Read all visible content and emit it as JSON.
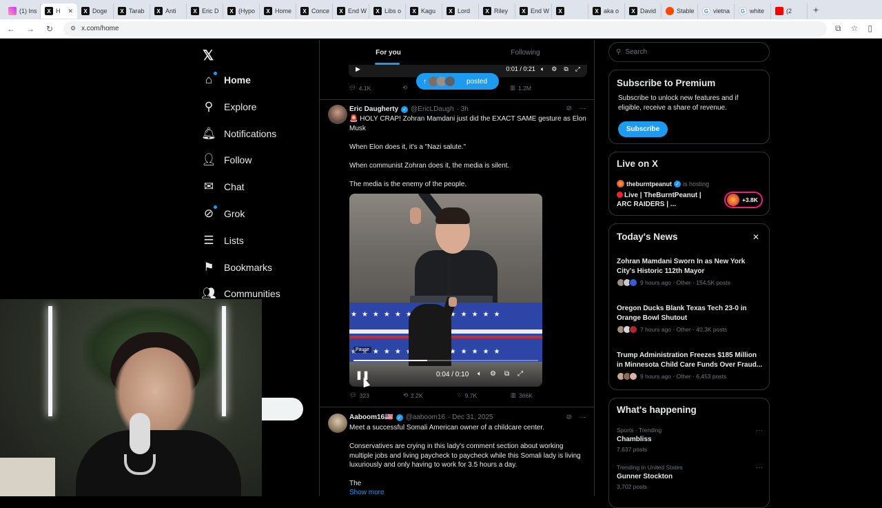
{
  "browser": {
    "tabs": [
      {
        "label": "(1) Ins",
        "fav": "ig"
      },
      {
        "label": "H",
        "fav": "x",
        "active": true
      },
      {
        "label": "Doge",
        "fav": "x"
      },
      {
        "label": "Tarab",
        "fav": "x"
      },
      {
        "label": "Anti",
        "fav": "x"
      },
      {
        "label": "Eric D",
        "fav": "x"
      },
      {
        "label": "(Hypo",
        "fav": "x"
      },
      {
        "label": "Home",
        "fav": "x"
      },
      {
        "label": "Conce",
        "fav": "x"
      },
      {
        "label": "End W",
        "fav": "x"
      },
      {
        "label": "Libs o",
        "fav": "x"
      },
      {
        "label": "Kagu",
        "fav": "x"
      },
      {
        "label": "Lord",
        "fav": "x"
      },
      {
        "label": "Riley",
        "fav": "x"
      },
      {
        "label": "End W",
        "fav": "x"
      },
      {
        "label": "",
        "fav": "x"
      },
      {
        "label": "aka o",
        "fav": "x"
      },
      {
        "label": "David",
        "fav": "x"
      },
      {
        "label": "Stable",
        "fav": "rd"
      },
      {
        "label": "vietna",
        "fav": "gg"
      },
      {
        "label": "white",
        "fav": "gg"
      },
      {
        "label": "(2",
        "fav": "yt"
      }
    ],
    "url": "x.com/home"
  },
  "nav": {
    "items": [
      {
        "label": "Home",
        "icon": "home-icon",
        "glyph": "⌂",
        "dot": true,
        "active": true
      },
      {
        "label": "Explore",
        "icon": "search-icon",
        "glyph": "⚲"
      },
      {
        "label": "Notifications",
        "icon": "bell-icon",
        "glyph": "🔔︎"
      },
      {
        "label": "Follow",
        "icon": "follow-icon",
        "glyph": "👤︎"
      },
      {
        "label": "Chat",
        "icon": "mail-icon",
        "glyph": "✉"
      },
      {
        "label": "Grok",
        "icon": "grok-icon",
        "glyph": "⊘",
        "dot": true
      },
      {
        "label": "Lists",
        "icon": "lists-icon",
        "glyph": "☰"
      },
      {
        "label": "Bookmarks",
        "icon": "bookmark-icon",
        "glyph": "⚑"
      },
      {
        "label": "Communities",
        "icon": "communities-icon",
        "glyph": "👥︎"
      }
    ]
  },
  "feed": {
    "tabs": [
      "For you",
      "Following"
    ],
    "top_video_time": "0:01 / 0:21",
    "posted_label": "posted",
    "top_actions": {
      "replies": "4.1K",
      "reposts": "",
      "likes": "",
      "views": "1.2M"
    },
    "posts": [
      {
        "name": "Eric Daugherty",
        "handle": "@EricLDaugh",
        "time": "· 3h",
        "text": [
          "🚨 HOLY CRAP! Zohran Mamdani just did the EXACT SAME gesture as Elon Musk",
          "When Elon does it, it's a \"Nazi salute.\"",
          "When communist Zohran does it, the media is silent.",
          "The media is the enemy of the people."
        ],
        "video": {
          "time": "0:04 / 0:10",
          "tooltip": "Pause",
          "progress": 0.4
        },
        "actions": {
          "replies": "323",
          "reposts": "2.2K",
          "likes": "9.7K",
          "views": "366K"
        }
      },
      {
        "name": "Aaboom16🇺🇸",
        "handle": "@aaboom16",
        "time": "· Dec 31, 2025",
        "text": [
          "Meet a successful Somali American owner of a childcare center.",
          "Conservatives are crying in this lady's comment section about working multiple jobs and living paycheck to paycheck while this Somali lady is living luxuriously and only having to work for 3.5 hours a day.",
          "The"
        ],
        "show_more": "Show more"
      }
    ]
  },
  "right": {
    "search_placeholder": "Search",
    "premium": {
      "title": "Subscribe to Premium",
      "desc": "Subscribe to unlock new features and if eligible, receive a share of revenue.",
      "button": "Subscribe"
    },
    "live": {
      "title": "Live on X",
      "host": "theburntpeanut",
      "hosting": "is hosting",
      "stream": "Live | TheBurntPeanut | ARC RAIDERS | ...",
      "count": "+3.8K"
    },
    "news": {
      "title": "Today's News",
      "items": [
        {
          "title": "Zohran Mamdani Sworn In as New York City's Historic 112th Mayor",
          "meta": "9 hours ago · Other · 154.5K posts"
        },
        {
          "title": "Oregon Ducks Blank Texas Tech 23-0 in Orange Bowl Shutout",
          "meta": "7 hours ago · Other · 40.3K posts"
        },
        {
          "title": "Trump Administration Freezes $185 Million in Minnesota Child Care Funds Over Fraud...",
          "meta": "9 hours ago · Other · 6,453 posts"
        }
      ]
    },
    "happening": {
      "title": "What's happening",
      "trends": [
        {
          "context": "Sports · Trending",
          "name": "Chambliss",
          "count": "7,637 posts"
        },
        {
          "context": "Trending in United States",
          "name": "Gunner Stockton",
          "count": "3,702 posts"
        }
      ]
    }
  }
}
